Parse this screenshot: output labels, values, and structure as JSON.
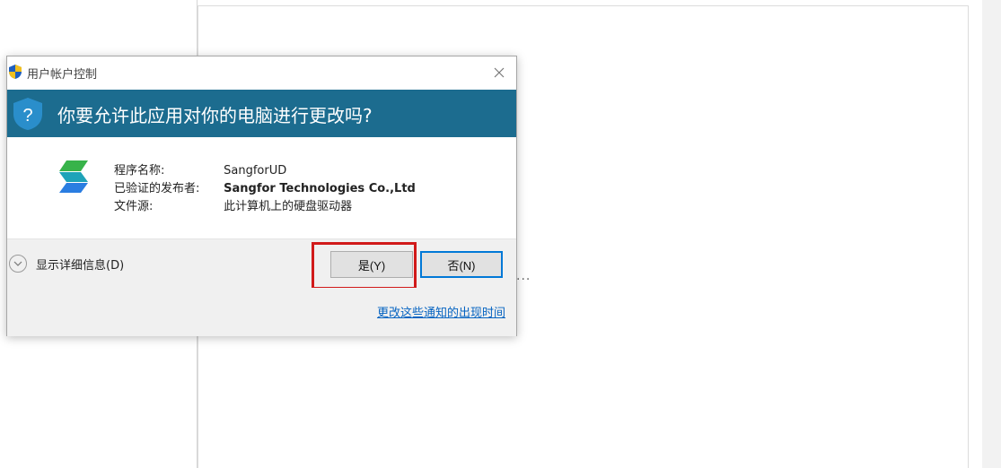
{
  "dialog": {
    "title": "用户帐户控制",
    "close_icon": "close-icon",
    "question": "你要允许此应用对你的电脑进行更改吗?",
    "fields": [
      {
        "label": "程序名称:",
        "value": "SangforUD"
      },
      {
        "label": "已验证的发布者:",
        "value": "Sangfor Technologies Co.,Ltd"
      },
      {
        "label": "文件源:",
        "value": "此计算机上的硬盘驱动器"
      }
    ],
    "details_label": "显示详细信息(D)",
    "yes_label": "是(Y)",
    "no_label": "否(N)",
    "change_link": "更改这些通知的出现时间"
  },
  "background": {
    "ellipsis": "..."
  },
  "colors": {
    "header_band": "#1c6c8f",
    "highlight": "#d11a1a",
    "link": "#0563c1",
    "default_button_border": "#0078d7"
  }
}
